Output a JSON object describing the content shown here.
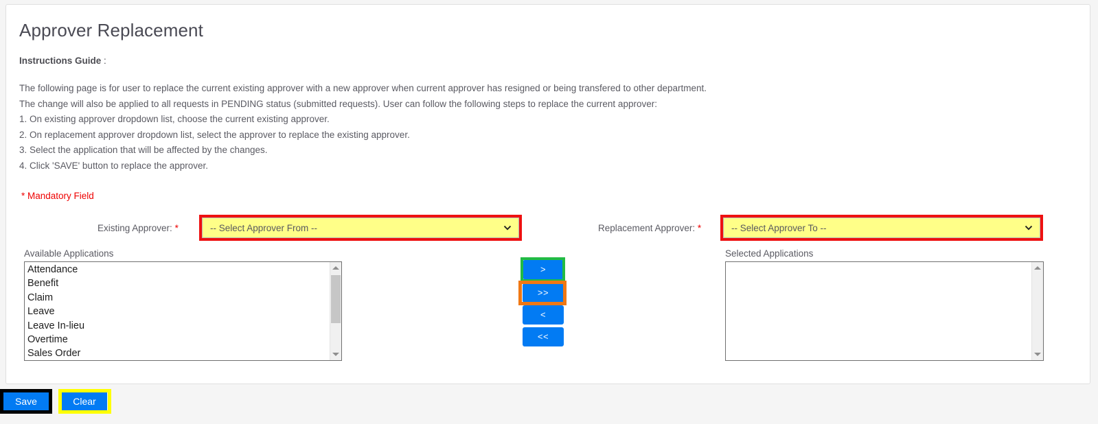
{
  "page": {
    "title": "Approver Replacement",
    "instructions_heading": "Instructions Guide",
    "instructions_heading_colon": " :",
    "instructions": [
      "The following page is for user to replace the current existing approver with a new approver when current approver has resigned or being transfered to other department.",
      "The change will also be applied to all requests in PENDING status (submitted requests). User can follow the following steps to replace the current approver:",
      "1. On existing approver dropdown list, choose the current existing approver.",
      "2. On replacement approver dropdown list, select the approver to replace the existing approver.",
      "3. Select the application that will be affected by the changes.",
      "4. Click 'SAVE' button to replace the approver."
    ],
    "mandatory_note": "* Mandatory Field"
  },
  "form": {
    "existing_approver": {
      "label": "Existing Approver:",
      "required_mark": "*",
      "selected_value": "-- Select Approver From --",
      "highlight_color": "#ee1111",
      "field_background": "#ffff88"
    },
    "replacement_approver": {
      "label": "Replacement Approver:",
      "required_mark": "*",
      "selected_value": "-- Select Approver To --",
      "highlight_color": "#ee1111",
      "field_background": "#ffff88"
    }
  },
  "transfer": {
    "available": {
      "caption": "Available Applications",
      "items": [
        "Attendance",
        "Benefit",
        "Claim",
        "Leave",
        "Leave In-lieu",
        "Overtime",
        "Sales Order"
      ]
    },
    "selected": {
      "caption": "Selected Applications",
      "items": []
    },
    "buttons": [
      {
        "name": "move-right",
        "label": ">",
        "highlight_color": "#22bb44"
      },
      {
        "name": "move-all-right",
        "label": ">>",
        "highlight_color": "#f07814"
      },
      {
        "name": "move-left",
        "label": "<",
        "highlight_color": null
      },
      {
        "name": "move-all-left",
        "label": "<<",
        "highlight_color": null
      }
    ],
    "button_color": "#027bf3"
  },
  "footer": {
    "save_label": "Save",
    "clear_label": "Clear",
    "save_highlight_color": "#000000",
    "clear_highlight_color": "#ffff00",
    "button_color": "#027bf3"
  }
}
